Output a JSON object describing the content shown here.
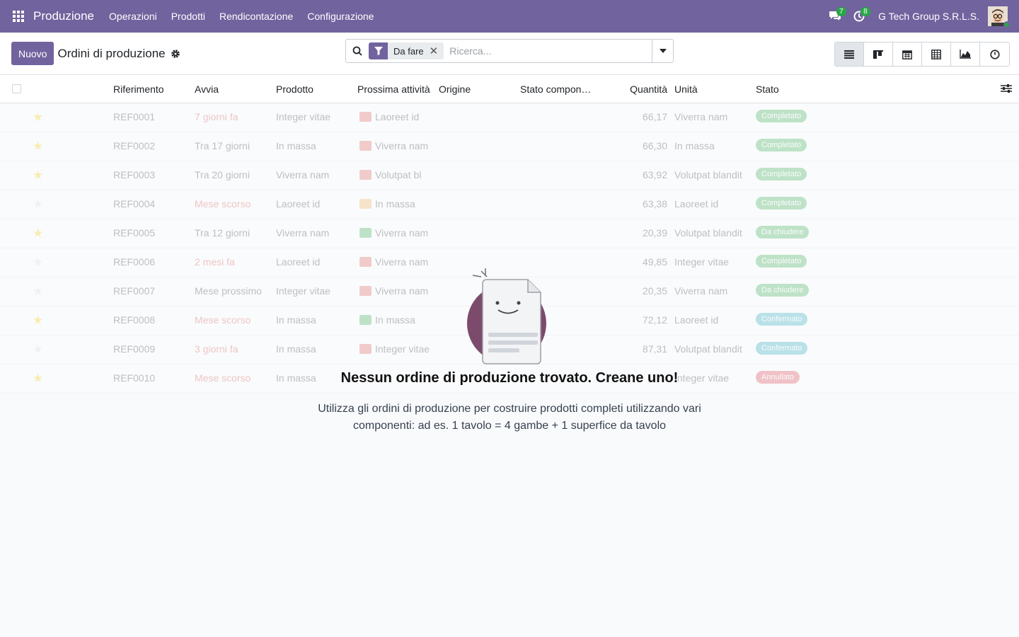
{
  "navbar": {
    "app_name": "Produzione",
    "menu": [
      "Operazioni",
      "Prodotti",
      "Rendicontazione",
      "Configurazione"
    ],
    "messages_count": "7",
    "activities_count": "8",
    "company": "G Tech Group S.R.L.S."
  },
  "control": {
    "new_label": "Nuovo",
    "title": "Ordini di produzione",
    "filter_facet": "Da fare",
    "search_placeholder": "Ricerca..."
  },
  "columns": {
    "reference": "Riferimento",
    "start": "Avvia",
    "product": "Prodotto",
    "next_activity": "Prossima attività",
    "origin": "Origine",
    "component_status": "Stato compon…",
    "quantity": "Quantità",
    "unit": "Unità",
    "state": "Stato"
  },
  "rows": [
    {
      "ref": "REF0001",
      "start": "7 giorni fa",
      "start_warn": true,
      "product": "Integer vitae",
      "activity": "Laoreet id",
      "activity_color": "#d9534f",
      "qty": "66,17",
      "unit": "Viverra nam",
      "state": "Completato",
      "state_color": "#28a745",
      "starred": true
    },
    {
      "ref": "REF0002",
      "start": "Tra 17 giorni",
      "start_warn": false,
      "product": "In massa",
      "activity": "Viverra nam",
      "activity_color": "#d9534f",
      "qty": "66,30",
      "unit": "In massa",
      "state": "Completato",
      "state_color": "#28a745",
      "starred": true
    },
    {
      "ref": "REF0003",
      "start": "Tra 20 giorni",
      "start_warn": false,
      "product": "Viverra nam",
      "activity": "Volutpat bl",
      "activity_color": "#d9534f",
      "qty": "63,92",
      "unit": "Volutpat blandit",
      "state": "Completato",
      "state_color": "#28a745",
      "starred": true
    },
    {
      "ref": "REF0004",
      "start": "Mese scorso",
      "start_warn": true,
      "product": "Laoreet id",
      "activity": "In massa",
      "activity_color": "#f0ad4e",
      "qty": "63,38",
      "unit": "Laoreet id",
      "state": "Completato",
      "state_color": "#28a745",
      "starred": false
    },
    {
      "ref": "REF0005",
      "start": "Tra 12 giorni",
      "start_warn": false,
      "product": "Viverra nam",
      "activity": "Viverra nam",
      "activity_color": "#28a745",
      "qty": "20,39",
      "unit": "Volutpat blandit",
      "state": "Da chiudere",
      "state_color": "#28a745",
      "starred": true
    },
    {
      "ref": "REF0006",
      "start": "2 mesi fa",
      "start_warn": true,
      "product": "Laoreet id",
      "activity": "Viverra nam",
      "activity_color": "#d9534f",
      "qty": "49,85",
      "unit": "Integer vitae",
      "state": "Completato",
      "state_color": "#28a745",
      "starred": false
    },
    {
      "ref": "REF0007",
      "start": "Mese prossimo",
      "start_warn": false,
      "product": "Integer vitae",
      "activity": "Viverra nam",
      "activity_color": "#d9534f",
      "qty": "20,35",
      "unit": "Viverra nam",
      "state": "Da chiudere",
      "state_color": "#28a745",
      "starred": false
    },
    {
      "ref": "REF0008",
      "start": "Mese scorso",
      "start_warn": true,
      "product": "In massa",
      "activity": "In massa",
      "activity_color": "#28a745",
      "qty": "72,12",
      "unit": "Laoreet id",
      "state": "Confermato",
      "state_color": "#17a2b8",
      "starred": true
    },
    {
      "ref": "REF0009",
      "start": "3 giorni fa",
      "start_warn": true,
      "product": "In massa",
      "activity": "Integer vitae",
      "activity_color": "#d9534f",
      "qty": "87,31",
      "unit": "Volutpat blandit",
      "state": "Confermato",
      "state_color": "#17a2b8",
      "starred": false
    },
    {
      "ref": "REF0010",
      "start": "Mese scorso",
      "start_warn": true,
      "product": "In massa",
      "activity": "",
      "activity_color": "",
      "qty": "",
      "unit": "Integer vitae",
      "state": "Annullato",
      "state_color": "#dc3545",
      "starred": true
    }
  ],
  "empty_state": {
    "title": "Nessun ordine di produzione trovato. Creane uno!",
    "text": "Utilizza gli ordini di produzione per costruire prodotti completi utilizzando vari componenti: ad es. 1 tavolo = 4 gambe + 1 superfice da tavolo"
  },
  "colors": {
    "brand": "#71639e",
    "badge": "#28a745"
  }
}
